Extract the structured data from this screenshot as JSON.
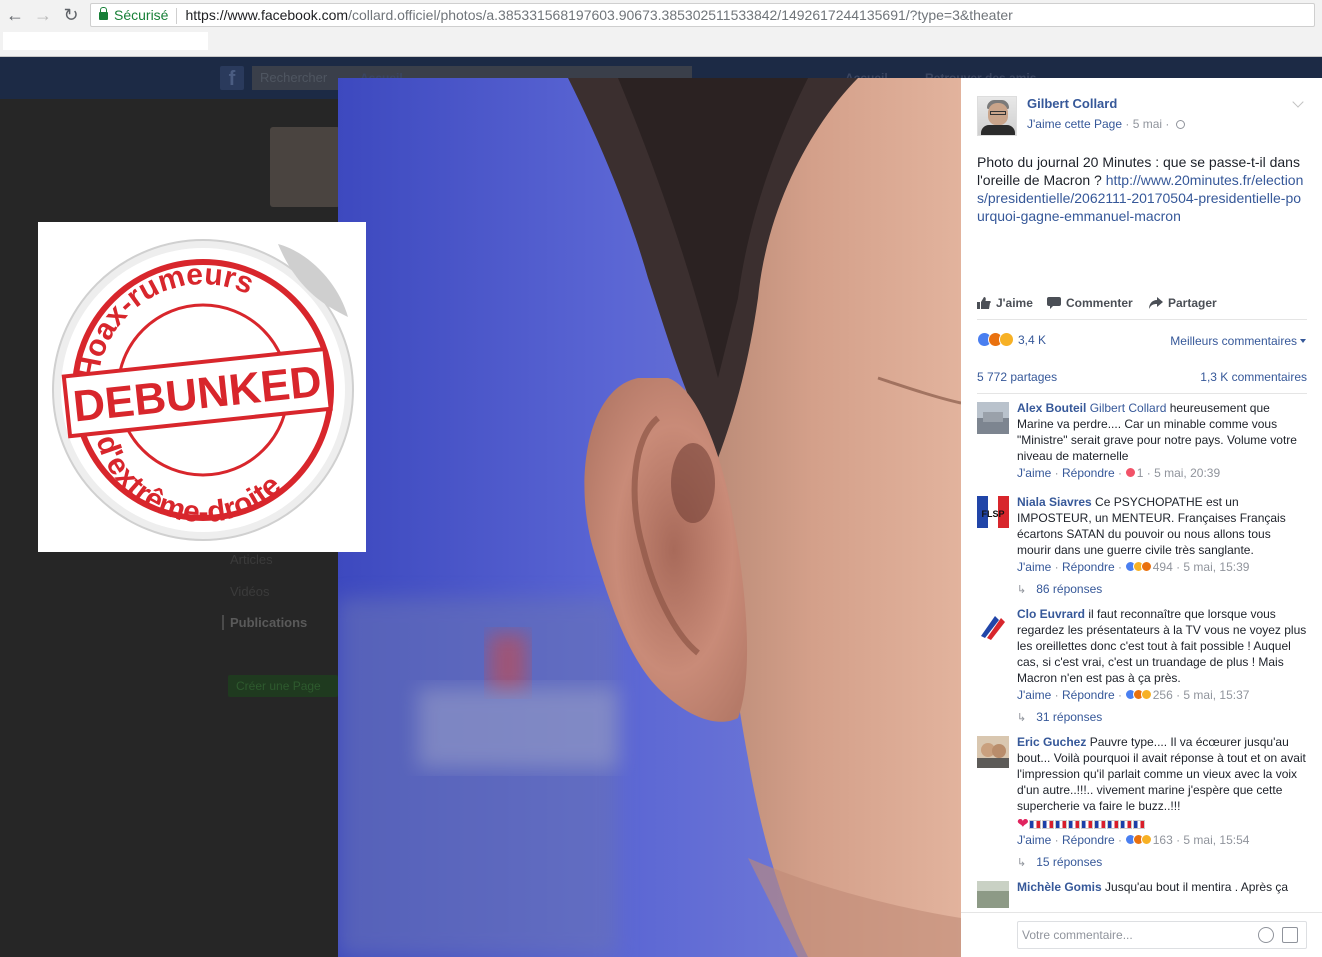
{
  "browser": {
    "secure_label": "Sécurisé",
    "url_base": "https://www.facebook.com",
    "url_rest": "/collard.officiel/photos/a.385331568197603.90673.385302511533842/1492617244135691/?type=3&theater"
  },
  "fb_background": {
    "search_placeholder": "Rechercher",
    "nav_left": "Accueil",
    "nav_home": "Accueil",
    "nav_find_friends": "Retrouver des amis",
    "side_items": [
      "Articles",
      "Vidéos"
    ],
    "side_active": "Publications",
    "create_page": "Créer une Page"
  },
  "stamp": {
    "top_text": "Hoax-rumeurs",
    "middle_text": "DEBUNKED",
    "bottom_text": "d'extrême-droite"
  },
  "post": {
    "page_name": "Gilbert Collard",
    "like_page": "J'aime cette Page",
    "date": "5 mai",
    "text": "Photo du journal 20 Minutes : que se passe-t-il dans l'oreille de Macron ? ",
    "link": "http://www.20minutes.fr/elections/presidentielle/2062111-20170504-presidentielle-pourquoi-gagne-emmanuel-macron",
    "actions": {
      "like": "J'aime",
      "comment": "Commenter",
      "share": "Partager"
    },
    "reactions_count": "3,4 K",
    "sort_label": "Meilleurs commentaires",
    "shares": "5 772 partages",
    "comments_count": "1,3 K commentaires",
    "compose_placeholder": "Votre commentaire..."
  },
  "comments": [
    {
      "author": "Alex Bouteil",
      "mention": "Gilbert Collard",
      "text": " heureusement que Marine va perdre.... Car un minable comme vous \"Ministre\" serait grave pour notre pays. Volume votre niveau de maternelle",
      "like": "J'aime",
      "reply": "Répondre",
      "reactions": "1",
      "time": "5 mai, 20:39",
      "replies": ""
    },
    {
      "author": "Niala Siavres",
      "mention": "",
      "text": " Ce PSYCHOPATHE est un IMPOSTEUR, un MENTEUR. Françaises Français écartons SATAN du pouvoir ou nous allons tous mourir dans une guerre civile très sanglante.",
      "like": "J'aime",
      "reply": "Répondre",
      "reactions": "494",
      "time": "5 mai, 15:39",
      "replies": "86 réponses"
    },
    {
      "author": "Clo Euvrard",
      "mention": "",
      "text": " il faut reconnaître que lorsque vous regardez les présentateurs à la TV vous ne voyez plus les oreillettes donc c'est tout à fait possible ! Auquel cas, si c'est vrai, c'est un truandage de plus ! Mais Macron n'en est pas à ça près.",
      "like": "J'aime",
      "reply": "Répondre",
      "reactions": "256",
      "time": "5 mai, 15:37",
      "replies": "31 réponses"
    },
    {
      "author": "Eric Guchez",
      "mention": "",
      "text": " Pauvre type.... Il va écœurer jusqu'au bout... Voilà pourquoi il avait réponse à tout et on avait l'impression qu'il parlait comme un vieux avec la voix d'un autre..!!!.. vivement marine j'espère que cette supercherie va faire le buzz..!!!",
      "like": "J'aime",
      "reply": "Répondre",
      "reactions": "163",
      "time": "5 mai, 15:54",
      "replies": "15 réponses"
    },
    {
      "author": "Michèle Gomis",
      "mention": "",
      "text": " Jusqu'au bout il mentira . Après ça",
      "like": "",
      "reply": "",
      "reactions": "",
      "time": "",
      "replies": ""
    }
  ],
  "avatar_overlay_text": "FLSP",
  "colors": {
    "fb_link": "#365899",
    "stamp_red": "#d8262c",
    "photo_blue": "#4c57c4"
  }
}
